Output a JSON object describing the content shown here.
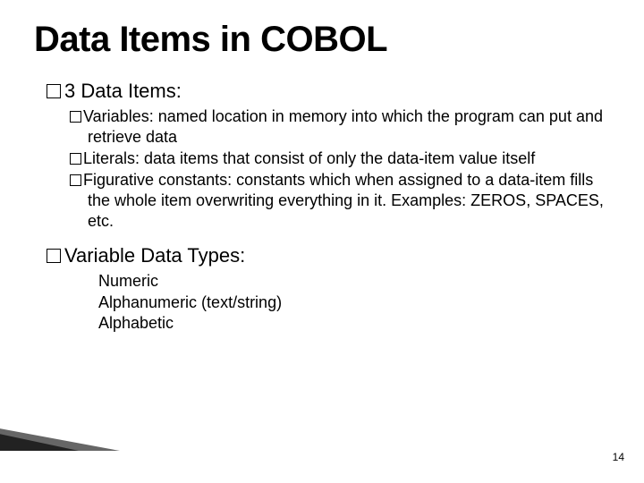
{
  "title": "Data Items in COBOL",
  "section1": {
    "lead_number": "3",
    "lead_text": "Data Items:",
    "items": [
      "Variables: named location in memory into which the program can put and retrieve data",
      "Literals: data items that consist of only the data-item value itself",
      "Figurative constants: constants which when assigned to a data-item fills the whole item overwriting everything in it. Examples: ZEROS, SPACES, etc."
    ]
  },
  "section2": {
    "lead_text": "Variable Data Types:",
    "types": [
      "Numeric",
      "Alphanumeric (text/string)",
      "Alphabetic"
    ]
  },
  "page_number": "14"
}
